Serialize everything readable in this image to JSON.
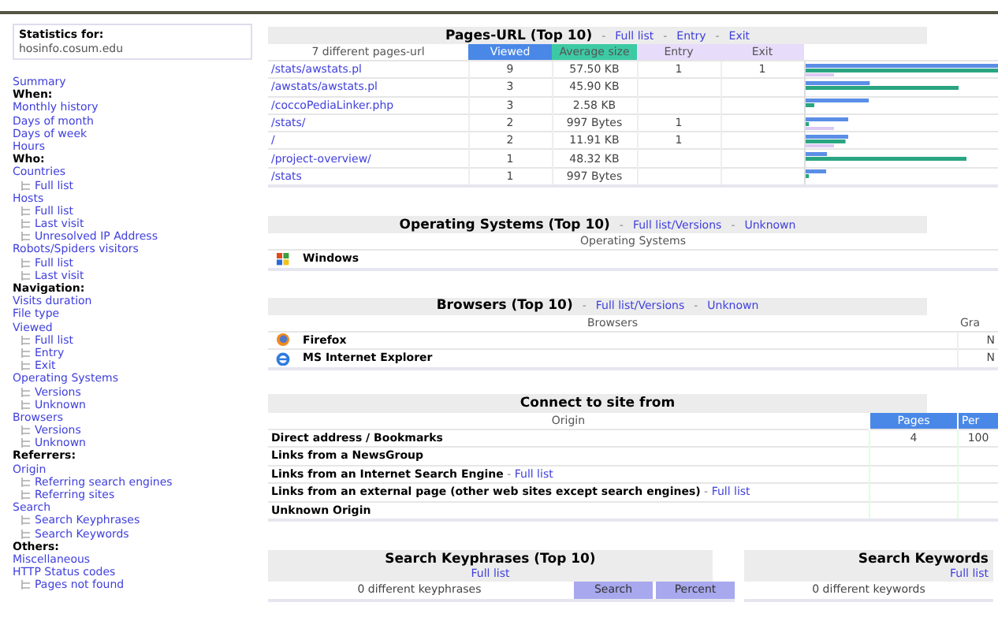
{
  "separator": "-",
  "sidebar": {
    "title": "Statistics for:",
    "site": "hosinfo.cosum.edu",
    "menu": [
      {
        "kind": "link",
        "text": "Summary"
      },
      {
        "kind": "heading",
        "text": "When:"
      },
      {
        "kind": "link",
        "text": "Monthly history"
      },
      {
        "kind": "link",
        "text": "Days of month"
      },
      {
        "kind": "link",
        "text": "Days of week"
      },
      {
        "kind": "link",
        "text": "Hours"
      },
      {
        "kind": "heading",
        "text": "Who:"
      },
      {
        "kind": "link",
        "text": "Countries",
        "children": [
          {
            "text": "Full list"
          }
        ]
      },
      {
        "kind": "link",
        "text": "Hosts",
        "children": [
          {
            "text": "Full list"
          },
          {
            "text": "Last visit"
          },
          {
            "text": "Unresolved IP Address"
          }
        ]
      },
      {
        "kind": "link",
        "text": "Robots/Spiders visitors",
        "children": [
          {
            "text": "Full list"
          },
          {
            "text": "Last visit"
          }
        ]
      },
      {
        "kind": "heading",
        "text": "Navigation:"
      },
      {
        "kind": "link",
        "text": "Visits duration"
      },
      {
        "kind": "link",
        "text": "File type"
      },
      {
        "kind": "link",
        "text": "Viewed",
        "children": [
          {
            "text": "Full list"
          },
          {
            "text": "Entry"
          },
          {
            "text": "Exit"
          }
        ]
      },
      {
        "kind": "link",
        "text": "Operating Systems",
        "children": [
          {
            "text": "Versions"
          },
          {
            "text": "Unknown"
          }
        ]
      },
      {
        "kind": "link",
        "text": "Browsers",
        "children": [
          {
            "text": "Versions"
          },
          {
            "text": "Unknown"
          }
        ]
      },
      {
        "kind": "heading",
        "text": "Referrers:"
      },
      {
        "kind": "link",
        "text": "Origin",
        "children": [
          {
            "text": "Referring search engines"
          },
          {
            "text": "Referring sites"
          }
        ]
      },
      {
        "kind": "link",
        "text": "Search",
        "children": [
          {
            "text": "Search Keyphrases"
          },
          {
            "text": "Search Keywords"
          }
        ]
      },
      {
        "kind": "heading",
        "text": "Others:"
      },
      {
        "kind": "link",
        "text": "Miscellaneous"
      },
      {
        "kind": "link",
        "text": "HTTP Status codes",
        "children": [
          {
            "text": "Pages not found"
          }
        ]
      }
    ]
  },
  "pages": {
    "title": "Pages-URL (Top 10)",
    "links": [
      "Full list",
      "Entry",
      "Exit"
    ],
    "columns": [
      "7 different pages-url",
      "Viewed",
      "Average size",
      "Entry",
      "Exit"
    ],
    "rows": [
      {
        "url": "/stats/awstats.pl",
        "viewed": "9",
        "size": "57.50 KB",
        "entry": "1",
        "exit": "1"
      },
      {
        "url": "/awstats/awstats.pl",
        "viewed": "3",
        "size": "45.90 KB"
      },
      {
        "url": "/coccoPediaLinker.php",
        "viewed": "3",
        "size": "2.58 KB"
      },
      {
        "url": "/stats/",
        "viewed": "2",
        "size": "997 Bytes",
        "entry": "1"
      },
      {
        "url": "/",
        "viewed": "2",
        "size": "11.91 KB",
        "entry": "1"
      },
      {
        "url": "/project-overview/",
        "viewed": "1",
        "size": "48.32 KB"
      },
      {
        "url": "/stats",
        "viewed": "1",
        "size": "997 Bytes"
      }
    ]
  },
  "os": {
    "title": "Operating Systems (Top 10)",
    "links": [
      "Full list/Versions",
      "Unknown"
    ],
    "columns": [
      "Operating Systems"
    ],
    "rows": [
      {
        "name": "Windows"
      }
    ]
  },
  "browsers": {
    "title": "Browsers (Top 10)",
    "links": [
      "Full list/Versions",
      "Unknown"
    ],
    "columns": [
      "Browsers",
      "Gra"
    ],
    "rows": [
      {
        "name": "Firefox",
        "column_2": "N"
      },
      {
        "name": "MS Internet Explorer",
        "column_2": "N"
      }
    ]
  },
  "origin": {
    "title": "Connect to site from",
    "columns": [
      "Origin",
      "Pages",
      "Per"
    ],
    "rows": [
      {
        "label": "Direct address / Bookmarks",
        "pages": "4",
        "percent": "100"
      },
      {
        "label": "Links from a NewsGroup"
      },
      {
        "label": "Links from an Internet Search Engine",
        "link": "Full list"
      },
      {
        "label": "Links from an external page (other web sites except search engines)",
        "link": "Full list"
      },
      {
        "label": "Unknown Origin"
      }
    ]
  },
  "search": [
    {
      "title": "Search Keyphrases (Top 10)",
      "link": "Full list",
      "count": "0 different keyphrases",
      "columns": [
        "Search",
        "Percent"
      ]
    },
    {
      "title": "Search Keywords",
      "link": "Full list",
      "count": "0 different keywords"
    }
  ]
}
